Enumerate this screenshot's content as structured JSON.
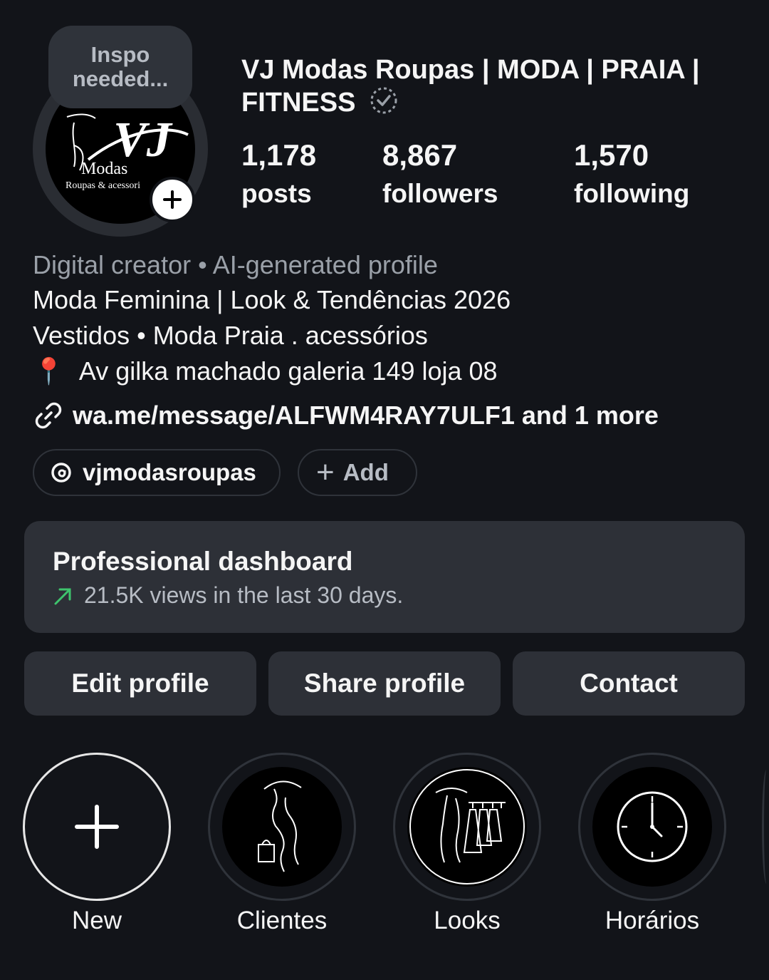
{
  "profile": {
    "inspo_note_line1": "Inspo",
    "inspo_note_line2": "needed...",
    "avatar_logo": {
      "letters": "VJ",
      "line1": "Modas",
      "line2": "Roupas & acessori"
    },
    "name_line1": "VJ Modas Roupas | MODA | PRAIA |",
    "name_line2": "FITNESS",
    "stats": [
      {
        "value": "1,178",
        "label": "posts"
      },
      {
        "value": "8,867",
        "label": "followers"
      },
      {
        "value": "1,570",
        "label": "following"
      }
    ]
  },
  "bio": {
    "category": "Digital creator • AI-generated profile",
    "line1": "Moda Feminina | Look & Tendências 2026",
    "line2": "Vestidos • Moda Praia . acessórios",
    "location_icon": "📍",
    "location": "Av gilka machado galeria 149 loja 08",
    "link": "wa.me/message/ALFWM4RAY7ULF1 and 1 more"
  },
  "chips": {
    "threads_handle": "vjmodasroupas",
    "add_label": "Add",
    "add_symbol": "+"
  },
  "dashboard": {
    "title": "Professional dashboard",
    "subtitle": "21.5K views in the last 30 days.",
    "trend_color": "#3ec46d"
  },
  "actions": {
    "edit": "Edit profile",
    "share": "Share profile",
    "contact": "Contact"
  },
  "highlights": [
    {
      "label": "New",
      "icon": "plus-icon"
    },
    {
      "label": "Clientes",
      "icon": "woman-shopping-icon"
    },
    {
      "label": "Looks",
      "icon": "boutique-icon"
    },
    {
      "label": "Horários",
      "icon": "clock-icon"
    }
  ]
}
